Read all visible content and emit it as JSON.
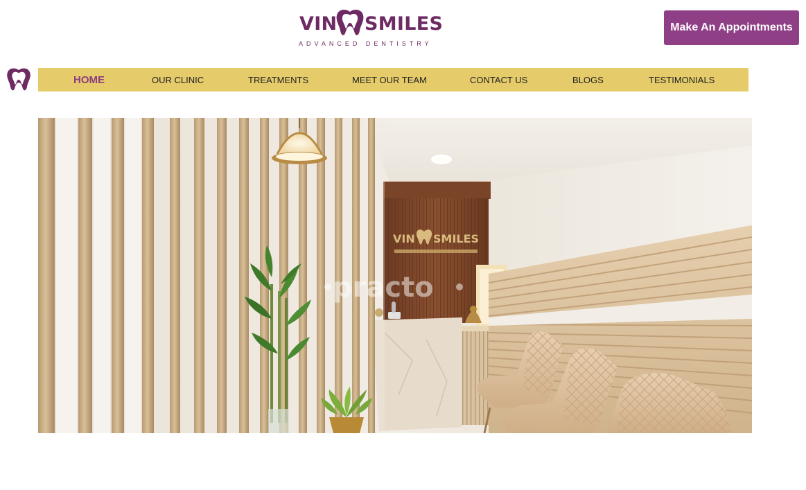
{
  "header": {
    "logo": {
      "left_word": "VIN",
      "right_word": "SMILES",
      "tagline": "ADVANCED DENTISTRY",
      "icon": "tooth-icon",
      "brand_color": "#6e2a62"
    },
    "cta_label": "Make An Appointments",
    "cta_color": "#8f3f86"
  },
  "nav": {
    "bar_color": "#e5cb69",
    "active_color": "#8d3d80",
    "items": [
      {
        "label": "HOME",
        "active": true
      },
      {
        "label": "OUR CLINIC",
        "active": false
      },
      {
        "label": "TREATMENTS",
        "active": false
      },
      {
        "label": "MEET OUR TEAM",
        "active": false
      },
      {
        "label": "CONTACT US",
        "active": false
      },
      {
        "label": "BLOGS",
        "active": false
      },
      {
        "label": "TESTIMONIALS",
        "active": false
      }
    ]
  },
  "hero": {
    "description": "Clinic reception photo",
    "wall_sign": {
      "left_word": "VIN",
      "right_word": "SMILES"
    },
    "watermark": "practo"
  }
}
